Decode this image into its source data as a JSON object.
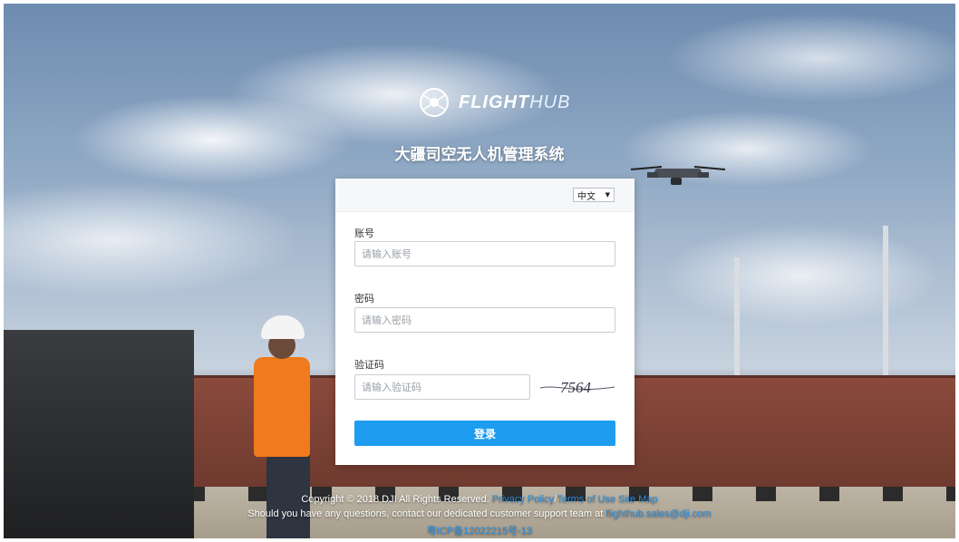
{
  "brand": {
    "logo_text_main": "FLIGHT",
    "logo_text_accent": "HUB",
    "system_title": "大疆司空无人机管理系统"
  },
  "language": {
    "selected": "中文"
  },
  "form": {
    "account_label": "账号",
    "account_placeholder": "请输入账号",
    "password_label": "密码",
    "password_placeholder": "请输入密码",
    "captcha_label": "验证码",
    "captcha_placeholder": "请输入验证码",
    "captcha_text": "7564",
    "submit_label": "登录"
  },
  "footer": {
    "copyright": "Copyright © 2018 DJI All Rights Reserved.",
    "links": [
      "Privacy Policy",
      "Terms of Use",
      "Site Map"
    ],
    "link_separator": "/",
    "support_text": "Should you have any questions, contact our dedicated customer support team at",
    "support_email": "flighthub.sales@dji.com",
    "icp": "粤ICP备12022215号-13"
  },
  "colors": {
    "primary_button": "#1e9cf0",
    "link": "#2a8fe0"
  },
  "icons": {
    "logo": "flighthub-logo-icon",
    "drone": "drone-illustration",
    "caret": "caret-down-icon"
  }
}
